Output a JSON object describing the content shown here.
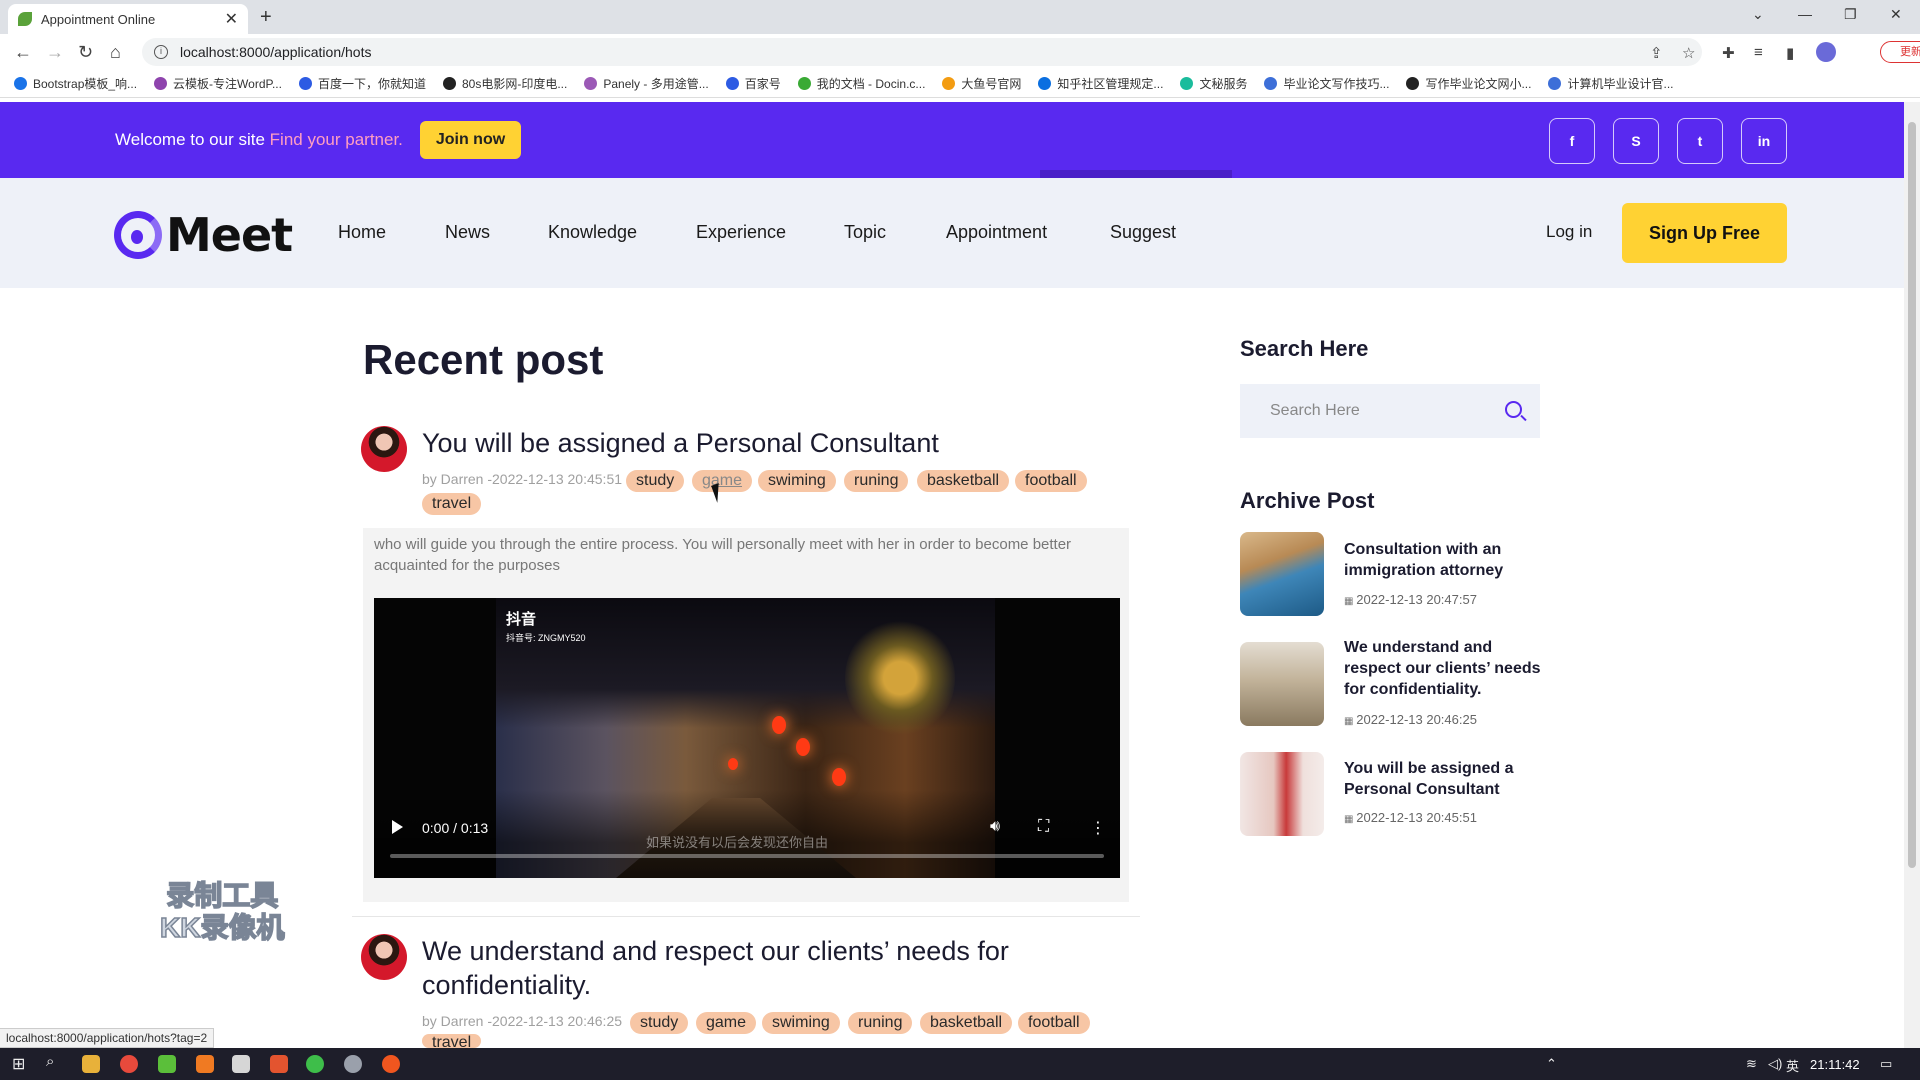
{
  "browser": {
    "tab_title": "Appointment Online",
    "url": "localhost:8000/application/hots",
    "update_label": "更新",
    "bookmarks": [
      "Bootstrap模板_响...",
      "云模板-专注WordP...",
      "百度一下，你就知道",
      "80s电影网-印度电...",
      "Panely - 多用途管...",
      "百家号",
      "我的文档 - Docin.c...",
      "大鱼号官网",
      "知乎社区管理规定...",
      "文秘服务",
      "毕业论文写作技巧...",
      "写作毕业论文网小...",
      "计算机毕业设计官..."
    ],
    "status_url": "localhost:8000/application/hots?tag=2"
  },
  "top": {
    "welcome": "Welcome to our site",
    "highlight": "Find your partner.",
    "join": "Join now",
    "social": [
      "f",
      "S",
      "t",
      "in"
    ]
  },
  "nav": {
    "logo": "Meet",
    "links": [
      "Home",
      "News",
      "Knowledge",
      "Experience",
      "Topic",
      "Appointment",
      "Suggest"
    ],
    "login": "Log in",
    "signup": "Sign Up Free"
  },
  "main": {
    "heading": "Recent post",
    "posts": [
      {
        "title": "You will be assigned a Personal Consultant",
        "meta": "by Darren -2022-12-13 20:45:51",
        "tags": [
          "study",
          "game",
          "swiming",
          "runing",
          "basketball",
          "football",
          "travel"
        ],
        "excerpt": "who will guide you through the entire process. You will personally meet with her in order to become better acquainted for the purposes",
        "video": {
          "time": "0:00 / 0:13",
          "brand": "抖音",
          "account": "抖音号: ZNGMY520",
          "subtitle": "如果说没有以后会发现还你自由",
          "progress": 0
        }
      },
      {
        "title_line1": "We understand and respect our clients’ needs for",
        "title_line2": "confidentiality.",
        "meta": "by Darren -2022-12-13 20:46:25",
        "tags": [
          "study",
          "game",
          "swiming",
          "runing",
          "basketball",
          "football",
          "travel"
        ]
      }
    ]
  },
  "sidebar": {
    "search_heading": "Search Here",
    "search_placeholder": "Search Here",
    "archive_heading": "Archive Post",
    "archive": [
      {
        "title": "Consultation with an immigration attorney",
        "date": "2022-12-13 20:47:57"
      },
      {
        "title": "We understand and respect our clients’ needs for confidentiality.",
        "date": "2022-12-13 20:46:25"
      },
      {
        "title": "You will be assigned a Personal Consultant",
        "date": "2022-12-13 20:45:51"
      }
    ]
  },
  "watermark": {
    "line1": "录制工具",
    "line2": "KK录像机"
  },
  "taskbar": {
    "clock": "21:11:42",
    "ime": "英"
  },
  "colors": {
    "brand": "#5929f0",
    "accent": "#ffd233",
    "tag": "#f7c6a5",
    "highlight": "#ff9ec1"
  }
}
